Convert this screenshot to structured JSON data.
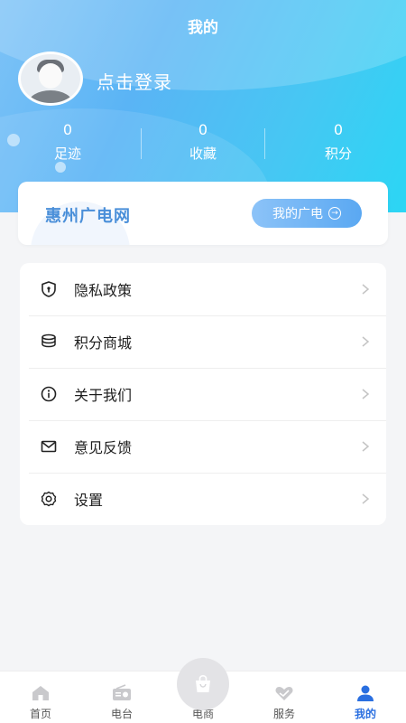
{
  "header": {
    "title": "我的",
    "login_text": "点击登录"
  },
  "stats": [
    {
      "value": "0",
      "label": "足迹"
    },
    {
      "value": "0",
      "label": "收藏"
    },
    {
      "value": "0",
      "label": "积分"
    }
  ],
  "brand_card": {
    "name": "惠州广电网",
    "button_label": "我的广电"
  },
  "menu": {
    "items": [
      {
        "label": "隐私政策",
        "icon": "shield-icon"
      },
      {
        "label": "积分商城",
        "icon": "coins-icon"
      },
      {
        "label": "关于我们",
        "icon": "info-icon"
      },
      {
        "label": "意见反馈",
        "icon": "mail-icon"
      },
      {
        "label": "设置",
        "icon": "gear-icon"
      }
    ]
  },
  "tabbar": {
    "items": [
      {
        "label": "首页",
        "icon": "home-icon",
        "active": false
      },
      {
        "label": "电台",
        "icon": "radio-icon",
        "active": false
      },
      {
        "label": "电商",
        "icon": "shopping-bag-icon",
        "active": false
      },
      {
        "label": "服务",
        "icon": "service-icon",
        "active": false
      },
      {
        "label": "我的",
        "icon": "user-icon",
        "active": true
      }
    ]
  },
  "colors": {
    "accent": "#2a6fe0",
    "brand_text": "#4a8fd9",
    "header_gradient_start": "#7ec3f7",
    "header_gradient_end": "#2bd6f4"
  }
}
